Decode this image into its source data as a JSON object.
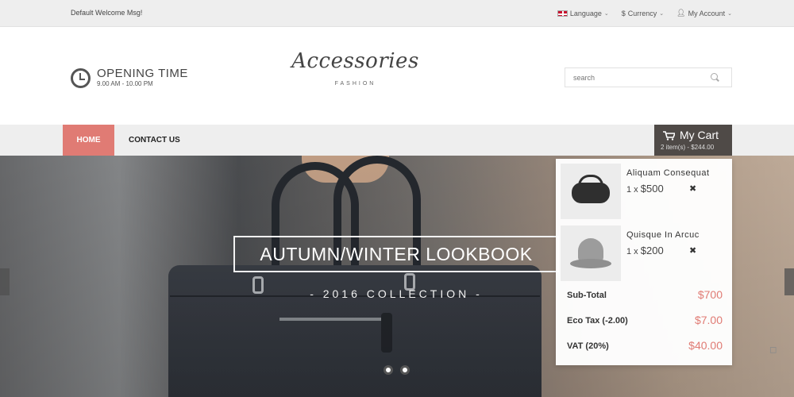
{
  "topbar": {
    "welcome": "Default Welcome Msg!",
    "language": "Language",
    "currency": "Currency",
    "account": "My Account",
    "currency_symbol": "$",
    "account_icon": "user-icon"
  },
  "header": {
    "opening_title": "OPENING TIME",
    "opening_hours": "9.00 AM - 10.00 PM",
    "logo_script": "Accessories",
    "logo_sub": "FASHION",
    "search_placeholder": "search"
  },
  "nav": {
    "home": "HOME",
    "contact": "CONTACT US",
    "accent_color": "#e07b74"
  },
  "cart": {
    "title": "My Cart",
    "summary": "2 item(s) - $244.00",
    "items": [
      {
        "name": "Aliquam Consequat",
        "qty": "1 x",
        "price": "$500",
        "thumb_icon": "duffel-bag-icon"
      },
      {
        "name": "Quisque In Arcuc",
        "qty": "1 x",
        "price": "$200",
        "thumb_icon": "hat-icon"
      }
    ],
    "totals": [
      {
        "label": "Sub-Total",
        "value": "$700"
      },
      {
        "label": "Eco Tax (-2.00)",
        "value": "$7.00"
      },
      {
        "label": "VAT (20%)",
        "value": "$40.00"
      }
    ]
  },
  "slider": {
    "title": "AUTUMN/WINTER LOOKBOOK",
    "subtitle": "- 2016 COLLECTION -"
  }
}
